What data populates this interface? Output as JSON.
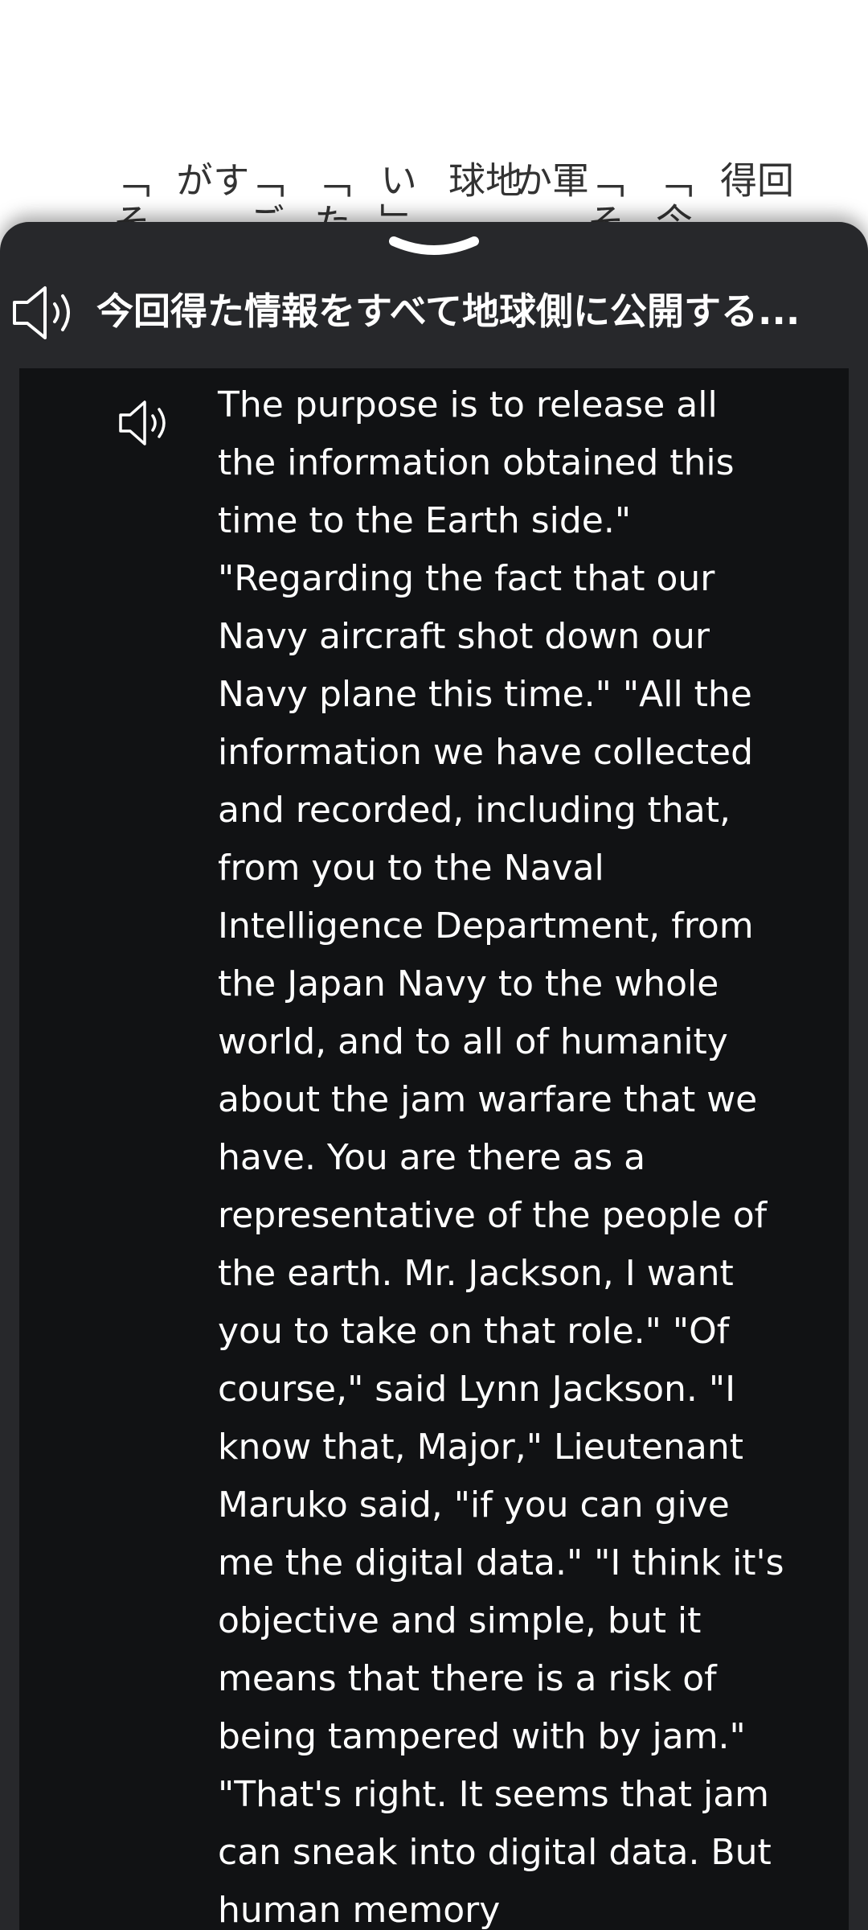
{
  "book_columns": [
    {
      "id": "c1",
      "text": "回得"
    },
    {
      "id": "c2",
      "text": "「今"
    },
    {
      "id": "c3",
      "text": "「そ"
    },
    {
      "id": "c4",
      "text": "軍か"
    },
    {
      "id": "c5",
      "text": "地球"
    },
    {
      "id": "c6",
      "text": "い」"
    },
    {
      "id": "c7",
      "text": "「た"
    },
    {
      "id": "c8",
      "text": "「ご"
    },
    {
      "id": "c9",
      "text": "すが"
    },
    {
      "id": "c10",
      "text": "「そ"
    }
  ],
  "sheet": {
    "header_title": "今回得た情報をすべて地球側に公開する...",
    "speaker_icon": "speaker-icon",
    "collapse_icon": "chevron-down-icon",
    "translation": "The purpose is to release all\nthe information obtained this\ntime to the Earth side.\"\n\"Regarding the fact that our\nNavy aircraft shot down our\nNavy plane this time.\" \"All the\ninformation we have collected\nand recorded, including that,\nfrom you to the Naval\nIntelligence Department, from\nthe Japan Navy to the whole\nworld, and to all of humanity\nabout the jam warfare that we\nhave. You are there as a\nrepresentative of the people of\nthe earth. Mr. Jackson, I want\nyou to take on that role.\" \"Of\ncourse,\" said Lynn Jackson. \"I\nknow that, Major,\" Lieutenant\nMaruko said, \"if you can give\nme the digital data.\" \"I think it's\nobjective and simple, but it\nmeans that there is a risk of\nbeing tampered with by jam.\"\n\"That's right. It seems that jam\ncan sneak into digital data. But\nhuman memory"
  },
  "colors": {
    "sheet_bg": "#27282b",
    "panel_bg": "#111214",
    "text": "#ffffff",
    "book_text": "#333333"
  }
}
